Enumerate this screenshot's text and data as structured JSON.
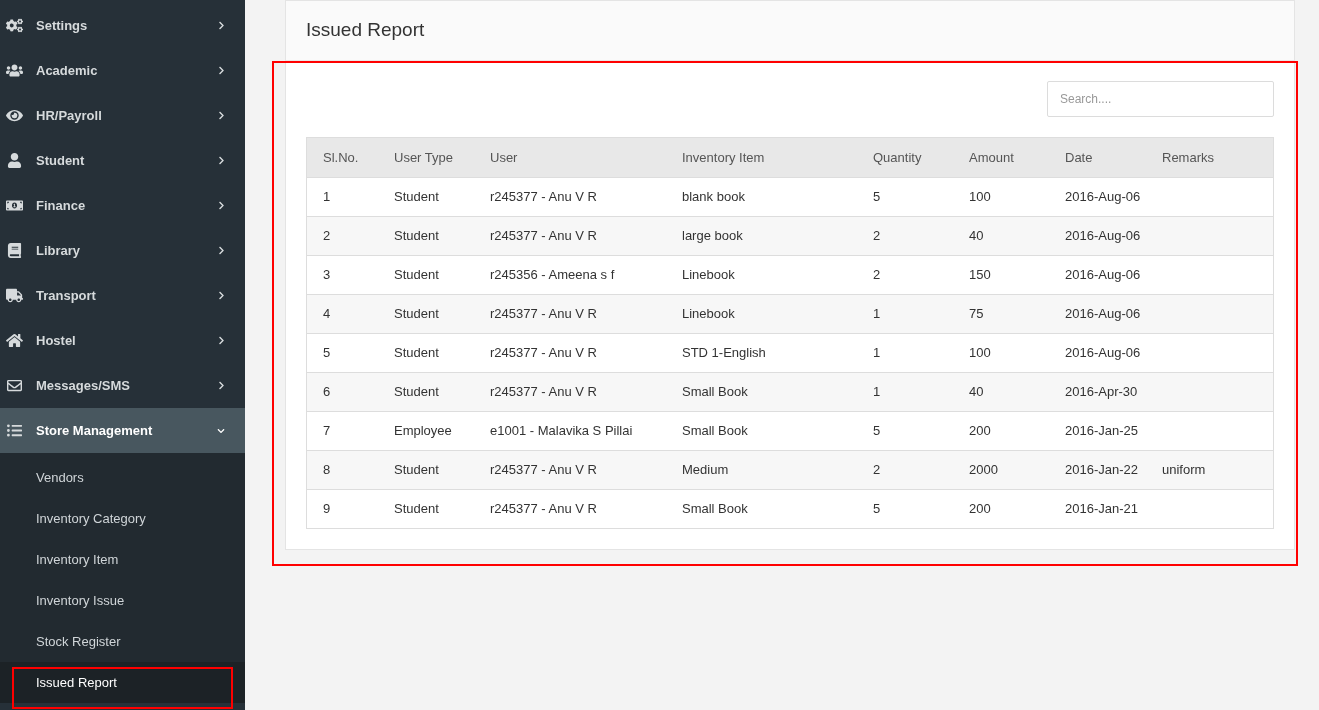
{
  "sidebar": {
    "items": [
      {
        "label": "Settings",
        "expanded": false,
        "selected": false
      },
      {
        "label": "Academic",
        "expanded": false,
        "selected": false
      },
      {
        "label": "HR/Payroll",
        "expanded": false,
        "selected": false
      },
      {
        "label": "Student",
        "expanded": false,
        "selected": false
      },
      {
        "label": "Finance",
        "expanded": false,
        "selected": false
      },
      {
        "label": "Library",
        "expanded": false,
        "selected": false
      },
      {
        "label": "Transport",
        "expanded": false,
        "selected": false
      },
      {
        "label": "Hostel",
        "expanded": false,
        "selected": false
      },
      {
        "label": "Messages/SMS",
        "expanded": false,
        "selected": false
      },
      {
        "label": "Store Management",
        "expanded": true,
        "selected": true,
        "children": [
          {
            "label": "Vendors",
            "selected": false,
            "highlighted": false
          },
          {
            "label": "Inventory Category",
            "selected": false,
            "highlighted": false
          },
          {
            "label": "Inventory Item",
            "selected": false,
            "highlighted": false
          },
          {
            "label": "Inventory Issue",
            "selected": false,
            "highlighted": false
          },
          {
            "label": "Stock Register",
            "selected": false,
            "highlighted": false
          },
          {
            "label": "Issued Report",
            "selected": true,
            "highlighted": true
          }
        ]
      }
    ]
  },
  "panel": {
    "title": "Issued Report",
    "highlighted": true,
    "search": {
      "placeholder": "Search...."
    },
    "table": {
      "columns": [
        "Sl.No.",
        "User Type",
        "User",
        "Inventory Item",
        "Quantity",
        "Amount",
        "Date",
        "Remarks"
      ],
      "rows": [
        [
          "1",
          "Student",
          "r245377 - Anu V R",
          "blank book",
          "5",
          "100",
          "2016-Aug-06",
          ""
        ],
        [
          "2",
          "Student",
          "r245377 - Anu V R",
          "large book",
          "2",
          "40",
          "2016-Aug-06",
          ""
        ],
        [
          "3",
          "Student",
          "r245356 - Ameena s f",
          "Linebook",
          "2",
          "150",
          "2016-Aug-06",
          ""
        ],
        [
          "4",
          "Student",
          "r245377 - Anu V R",
          "Linebook",
          "1",
          "75",
          "2016-Aug-06",
          ""
        ],
        [
          "5",
          "Student",
          "r245377 - Anu V R",
          "STD 1-English",
          "1",
          "100",
          "2016-Aug-06",
          ""
        ],
        [
          "6",
          "Student",
          "r245377 - Anu V R",
          "Small Book",
          "1",
          "40",
          "2016-Apr-30",
          ""
        ],
        [
          "7",
          "Employee",
          "e1001 - Malavika S Pillai",
          "Small Book",
          "5",
          "200",
          "2016-Jan-25",
          ""
        ],
        [
          "8",
          "Student",
          "r245377 - Anu V R",
          "Medium",
          "2",
          "2000",
          "2016-Jan-22",
          "uniform"
        ],
        [
          "9",
          "Student",
          "r245377 - Anu V R",
          "Small Book",
          "5",
          "200",
          "2016-Jan-21",
          ""
        ]
      ]
    }
  }
}
